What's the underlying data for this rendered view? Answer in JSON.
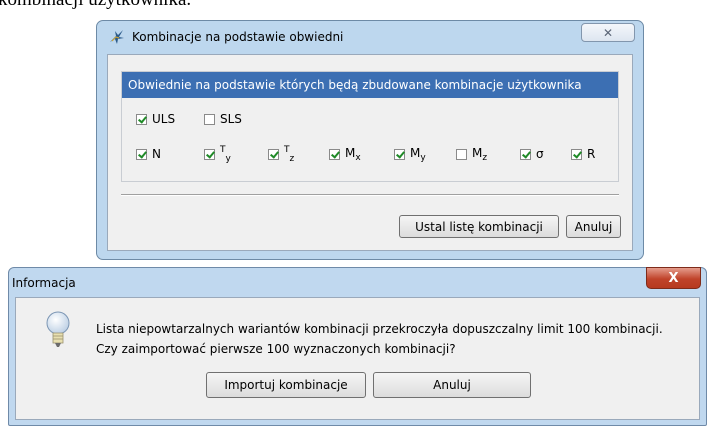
{
  "background": {
    "text": "kombinacji użytkownika."
  },
  "dialog_envelopes": {
    "title": "Kombinacje na podstawie obwiedni",
    "close_symbol": "✕",
    "group_header": "Obwiednie na podstawie których będą zbudowane kombinacje użytkownika",
    "limit_states": [
      {
        "label": "ULS",
        "checked": true
      },
      {
        "label": "SLS",
        "checked": false
      }
    ],
    "forces": [
      {
        "main": "N",
        "sub": "",
        "checked": true
      },
      {
        "main": "T",
        "sub": "y",
        "checked": true
      },
      {
        "main": "T",
        "sub": "z",
        "checked": true
      },
      {
        "main": "M",
        "sub": "x",
        "checked": true
      },
      {
        "main": "M",
        "sub": "y",
        "checked": true
      },
      {
        "main": "M",
        "sub": "z",
        "checked": false
      },
      {
        "main": "σ",
        "sub": "",
        "checked": true
      },
      {
        "main": "R",
        "sub": "",
        "checked": true
      }
    ],
    "buttons": {
      "set_list": "Ustal listę kombinacji",
      "cancel": "Anuluj"
    }
  },
  "dialog_info": {
    "title": "Informacja",
    "close_symbol": "X",
    "icon": "lightbulb-icon",
    "message_line1": "Lista niepowtarzalnych wariantów kombinacji przekroczyła dopuszczalny limit 100 kombinacji.",
    "message_line2": "Czy zaimportować pierwsze 100 wyznaczonych kombinacji?",
    "buttons": {
      "import": "Importuj kombinacje",
      "cancel": "Anuluj"
    }
  },
  "colors": {
    "window_frame": "#bdd7ee",
    "group_header_bg": "#3c6fb3",
    "close_red": "#c0432a",
    "check_green": "#1f8a27"
  }
}
